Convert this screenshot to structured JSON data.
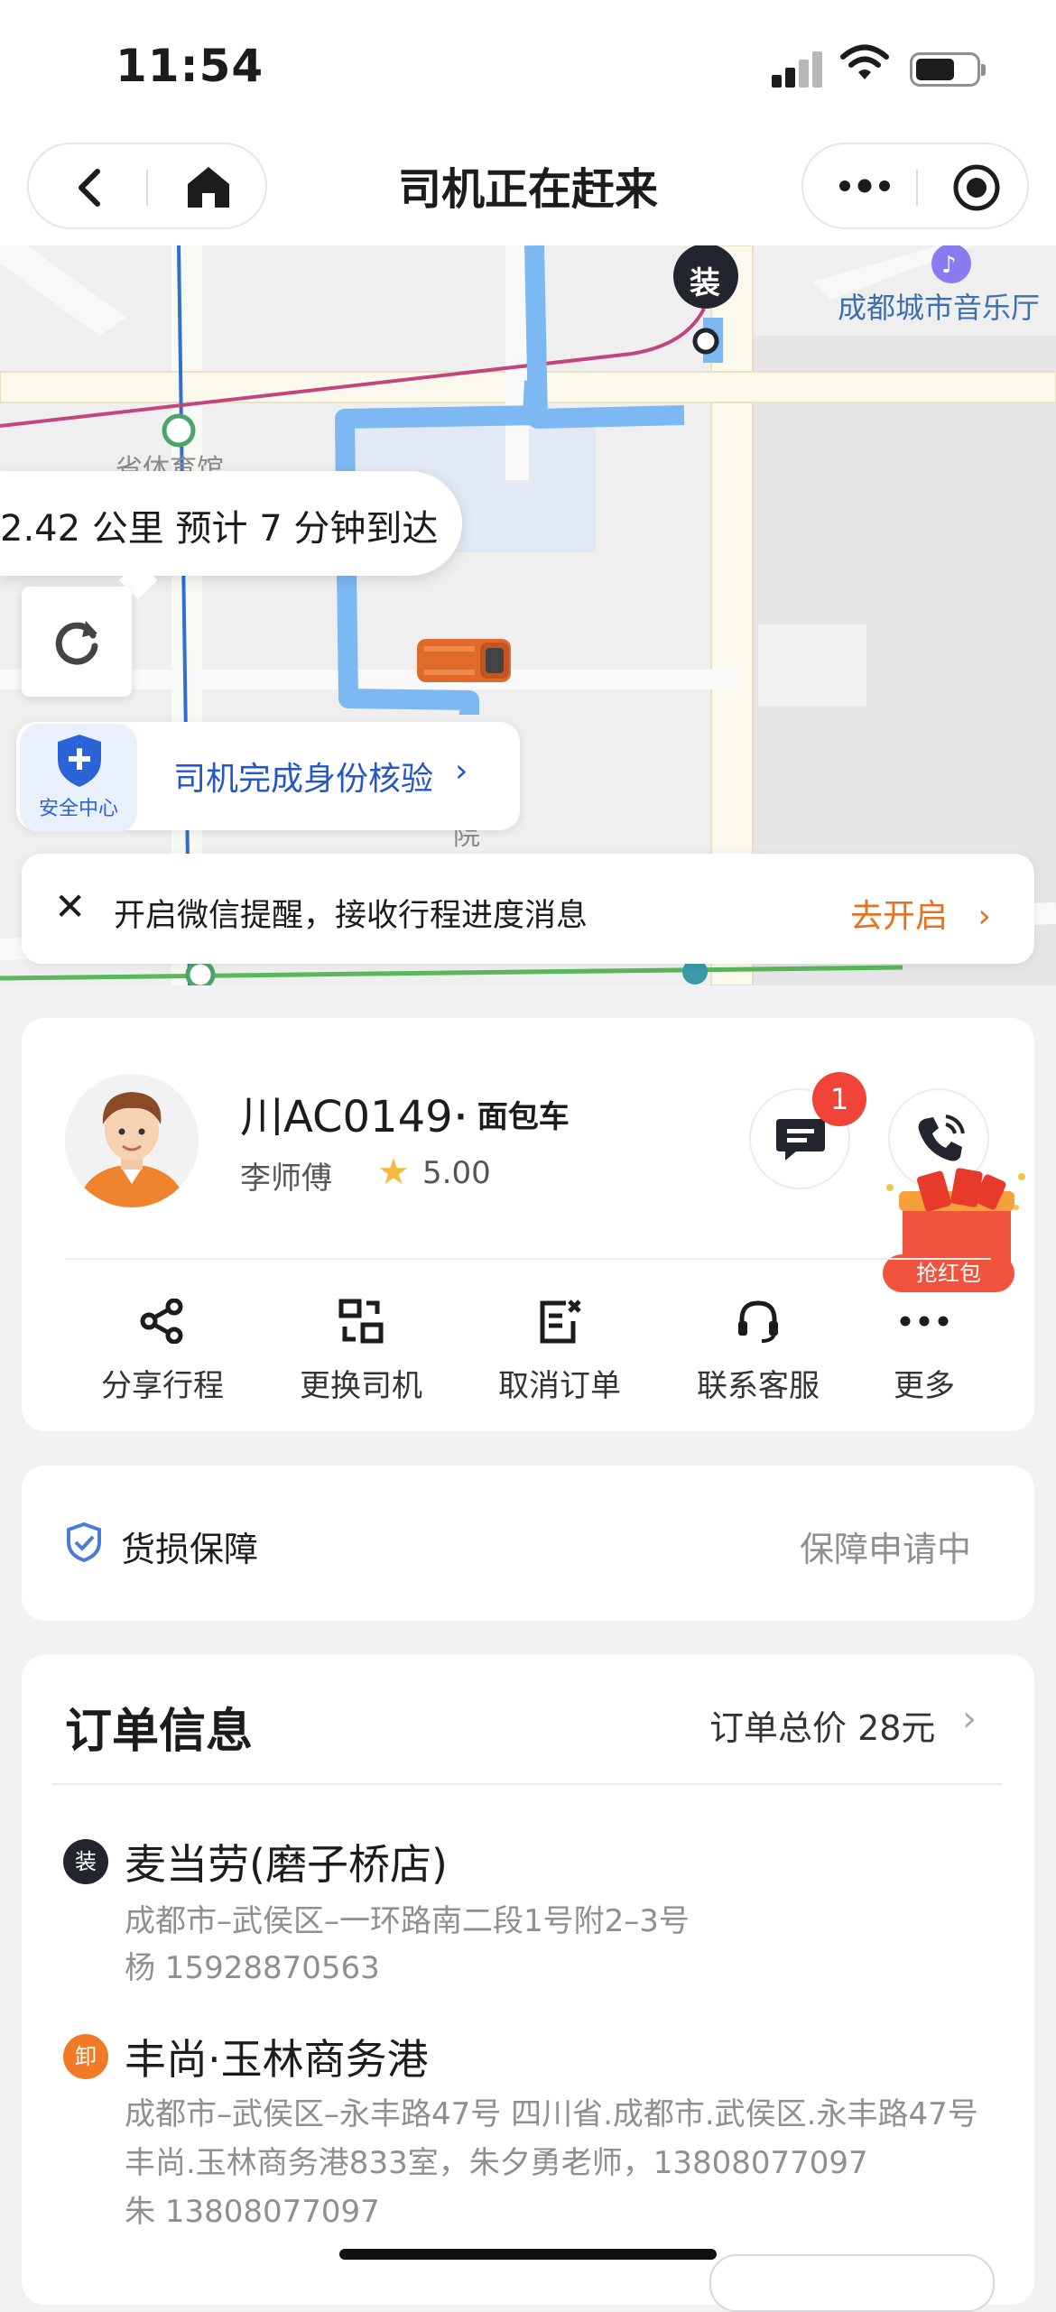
{
  "status_bar": {
    "time": "11:54"
  },
  "nav": {
    "title": "司机正在赶来"
  },
  "map": {
    "eta_text": "2.42 公里 预计 7 分钟到达",
    "load_marker": "装",
    "poi_label": "成都城市音乐厅",
    "place_fragment_1": "省体育馆",
    "place_fragment_2": "院",
    "safety": {
      "label": "安全中心",
      "text": "司机完成身份核验",
      "arrow": "›"
    },
    "wechat_banner": {
      "text": "开启微信提醒，接收行程进度消息",
      "button": "去开启",
      "arrow": "›"
    }
  },
  "driver": {
    "plate": "川AC0149",
    "vehicle_type": "· 面包车",
    "name": "李师傅",
    "rating": "5.00",
    "unread_count": "1",
    "red_packet_label": "抢红包",
    "actions": [
      {
        "label": "分享行程",
        "icon": "share-icon"
      },
      {
        "label": "更换司机",
        "icon": "swap-driver-icon"
      },
      {
        "label": "取消订单",
        "icon": "cancel-order-icon"
      },
      {
        "label": "联系客服",
        "icon": "headset-icon"
      },
      {
        "label": "更多",
        "icon": "more-icon"
      }
    ]
  },
  "insurance": {
    "title": "货损保障",
    "status": "保障申请中"
  },
  "order": {
    "title": "订单信息",
    "total": "订单总价 28元",
    "stops": [
      {
        "pin": "装",
        "name": "麦当劳(磨子桥店)",
        "address": "成都市–武侯区–一环路南二段1号附2–3号",
        "contact": "杨 15928870563"
      },
      {
        "pin": "卸",
        "name": "丰尚·玉林商务港",
        "address": "成都市–武侯区–永丰路47号 四川省.成都市.武侯区.永丰路47号丰尚.玉林商务港833室，朱夕勇老师，13808077097",
        "contact": "朱 13808077097"
      }
    ]
  },
  "colors": {
    "accent_orange": "#e8701e",
    "link_blue": "#2257c9",
    "route_blue": "#7cb8f2",
    "badge_red": "#f04438"
  }
}
